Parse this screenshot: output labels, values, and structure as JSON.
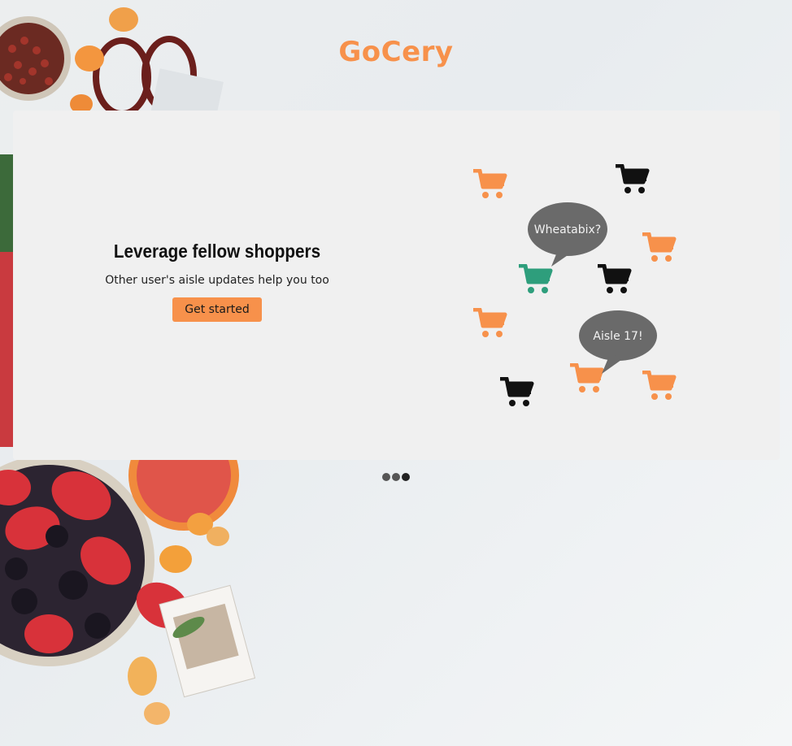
{
  "brand": {
    "logo_text": "GoCery",
    "accent_color": "#f7914b"
  },
  "slide": {
    "title": "Leverage fellow shoppers",
    "subtitle": "Other user's aisle updates help you too",
    "cta_label": "Get started"
  },
  "illustration": {
    "bubbles": [
      "Wheatabix?",
      "Aisle 17!"
    ],
    "icons": [
      "shopping-cart-icon",
      "speech-bubble-icon"
    ],
    "cart_colors": {
      "orange": "#f7914b",
      "black": "#111111",
      "teal": "#2e9e7c"
    }
  },
  "carousel": {
    "slide_count": 3,
    "active_index": 2
  }
}
